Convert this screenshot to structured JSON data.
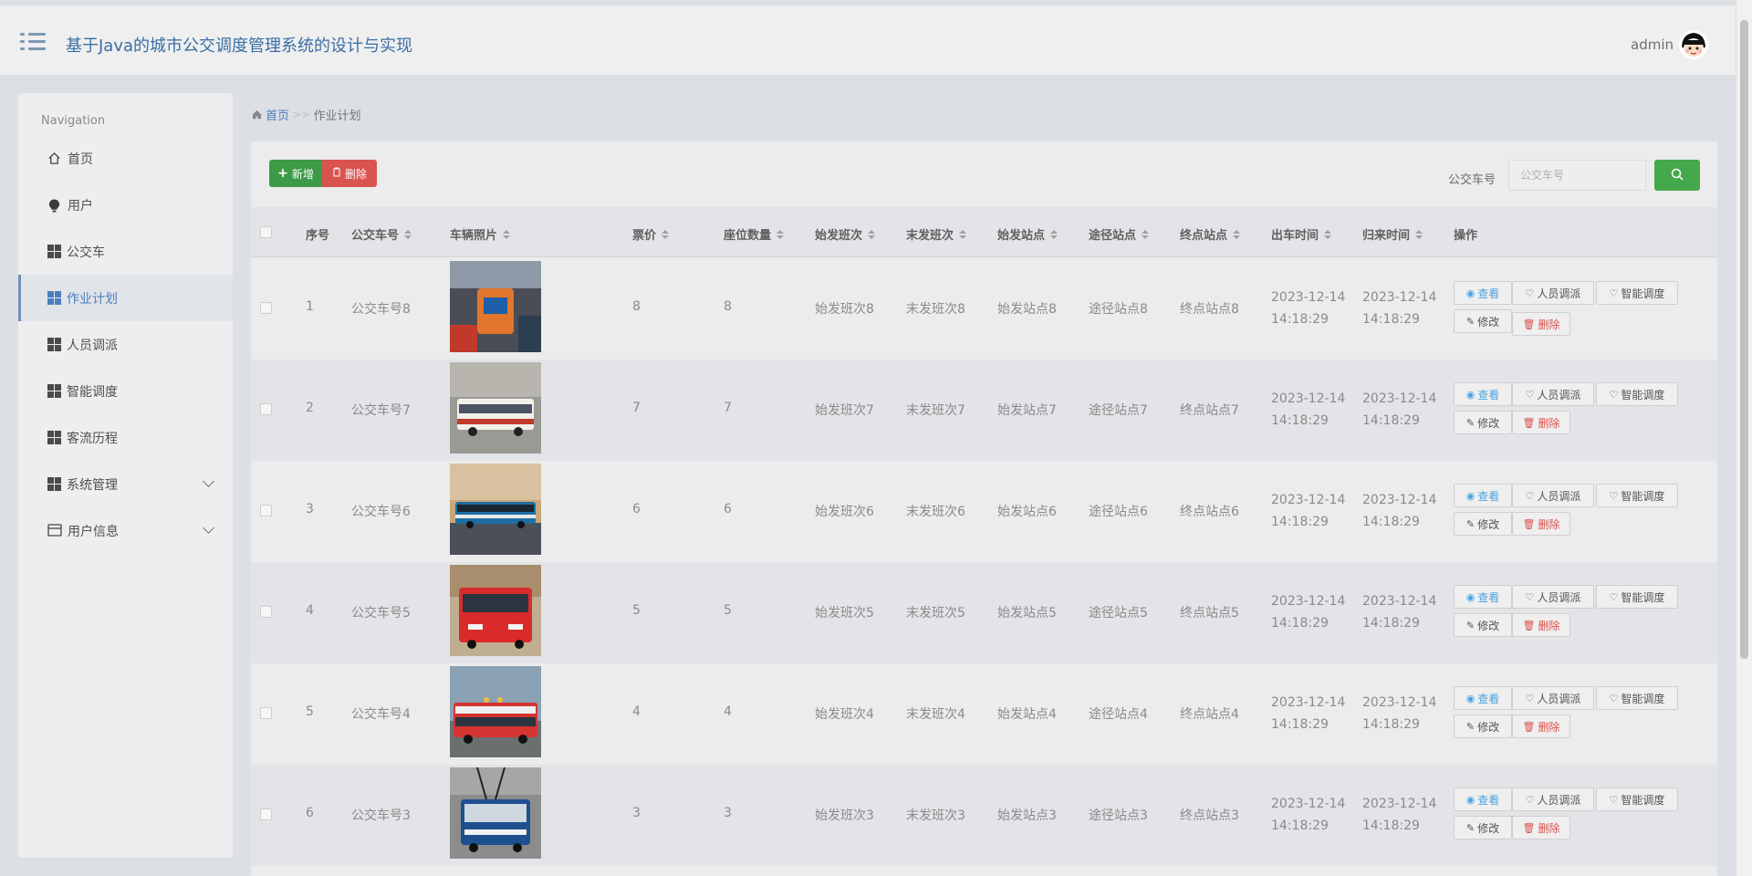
{
  "header": {
    "title": "基于Java的城市公交调度管理系统的设计与实现",
    "user": "admin"
  },
  "sidebar": {
    "heading": "Navigation",
    "items": [
      {
        "label": "首页",
        "icon": "home-icon"
      },
      {
        "label": "用户",
        "icon": "bulb-icon"
      },
      {
        "label": "公交车",
        "icon": "grid-icon"
      },
      {
        "label": "作业计划",
        "icon": "grid-icon",
        "active": true
      },
      {
        "label": "人员调派",
        "icon": "grid-icon"
      },
      {
        "label": "智能调度",
        "icon": "grid-icon"
      },
      {
        "label": "客流历程",
        "icon": "grid-icon"
      },
      {
        "label": "系统管理",
        "icon": "grid-icon"
      },
      {
        "label": "用户信息",
        "icon": "card-icon"
      }
    ]
  },
  "breadcrumb": {
    "home": "首页",
    "sep": ">>",
    "current": "作业计划"
  },
  "toolbar": {
    "add_label": "新增",
    "delete_label": "删除",
    "search_label": "公交车号",
    "search_placeholder": "公交车号"
  },
  "table": {
    "headers": [
      "序号",
      "公交车号",
      "车辆照片",
      "票价",
      "座位数量",
      "始发班次",
      "末发班次",
      "始发站点",
      "途径站点",
      "终点站点",
      "出车时间",
      "归来时间",
      "操作"
    ],
    "rows": [
      {
        "idx": "1",
        "bus": "公交车号8",
        "price": "8",
        "seats": "8",
        "first": "始发班次8",
        "last": "末发班次8",
        "start": "始发站点8",
        "via": "途径站点8",
        "end": "终点站点8",
        "out_date": "2023-12-14",
        "out_time": "14:18:29",
        "back_date": "2023-12-14",
        "back_time": "14:18:29"
      },
      {
        "idx": "2",
        "bus": "公交车号7",
        "price": "7",
        "seats": "7",
        "first": "始发班次7",
        "last": "末发班次7",
        "start": "始发站点7",
        "via": "途径站点7",
        "end": "终点站点7",
        "out_date": "2023-12-14",
        "out_time": "14:18:29",
        "back_date": "2023-12-14",
        "back_time": "14:18:29"
      },
      {
        "idx": "3",
        "bus": "公交车号6",
        "price": "6",
        "seats": "6",
        "first": "始发班次6",
        "last": "末发班次6",
        "start": "始发站点6",
        "via": "途径站点6",
        "end": "终点站点6",
        "out_date": "2023-12-14",
        "out_time": "14:18:29",
        "back_date": "2023-12-14",
        "back_time": "14:18:29"
      },
      {
        "idx": "4",
        "bus": "公交车号5",
        "price": "5",
        "seats": "5",
        "first": "始发班次5",
        "last": "末发班次5",
        "start": "始发站点5",
        "via": "途径站点5",
        "end": "终点站点5",
        "out_date": "2023-12-14",
        "out_time": "14:18:29",
        "back_date": "2023-12-14",
        "back_time": "14:18:29"
      },
      {
        "idx": "5",
        "bus": "公交车号4",
        "price": "4",
        "seats": "4",
        "first": "始发班次4",
        "last": "末发班次4",
        "start": "始发站点4",
        "via": "途径站点4",
        "end": "终点站点4",
        "out_date": "2023-12-14",
        "out_time": "14:18:29",
        "back_date": "2023-12-14",
        "back_time": "14:18:29"
      },
      {
        "idx": "6",
        "bus": "公交车号3",
        "price": "3",
        "seats": "3",
        "first": "始发班次3",
        "last": "末发班次3",
        "start": "始发站点3",
        "via": "途径站点3",
        "end": "终点站点3",
        "out_date": "2023-12-14",
        "out_time": "14:18:29",
        "back_date": "2023-12-14",
        "back_time": "14:18:29"
      }
    ],
    "actions": {
      "view": "查看",
      "assign": "人员调派",
      "dispatch": "智能调度",
      "edit": "修改",
      "remove": "删除"
    }
  },
  "colors": {
    "accent": "#3a6ea5",
    "add": "#3d9b48",
    "danger": "#d9534f",
    "search": "#46a84c",
    "view": "#4aa3df"
  }
}
